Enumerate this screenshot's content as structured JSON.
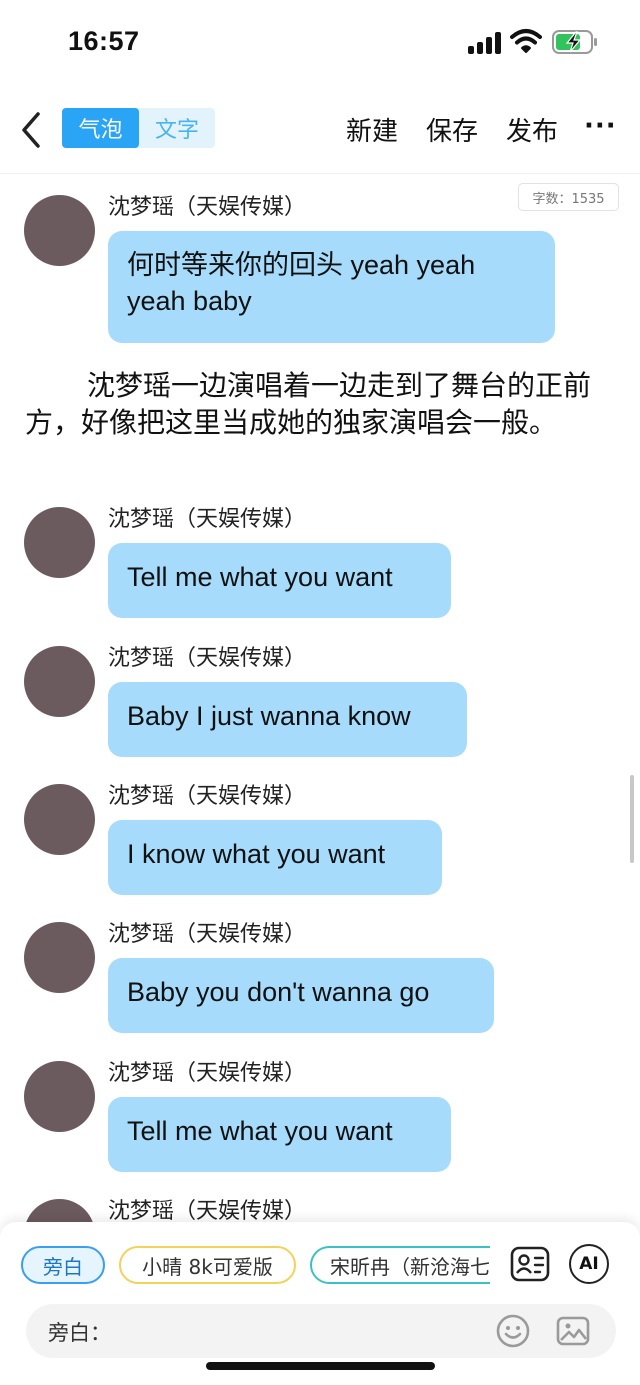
{
  "status": {
    "time": "16:57"
  },
  "nav": {
    "tab_bubble": "气泡",
    "tab_text": "文字",
    "new_label": "新建",
    "save_label": "保存",
    "publish_label": "发布",
    "more_label": "···"
  },
  "word_count": "字数：1535",
  "messages": [
    {
      "name": "沈梦瑶（天娱传媒）",
      "text": "何时等来你的回头 yeah yeah",
      "text2": "yeah baby"
    },
    {
      "name": "沈梦瑶（天娱传媒）",
      "text": "Tell me what you want"
    },
    {
      "name": "沈梦瑶（天娱传媒）",
      "text": "Baby I just wanna know"
    },
    {
      "name": "沈梦瑶（天娱传媒）",
      "text": "I know what you want"
    },
    {
      "name": "沈梦瑶（天娱传媒）",
      "text": "Baby you don't wanna go"
    },
    {
      "name": "沈梦瑶（天娱传媒）",
      "text": "Tell me what you want"
    },
    {
      "name": "沈梦瑶（天娱传媒）"
    }
  ],
  "narration": "沈梦瑶一边演唱着一边走到了舞台的正前方，好像把这里当成她的独家演唱会一般。",
  "bottom": {
    "chips": [
      "旁白",
      "小晴 8k可爱版",
      "宋昕冉（新沧海七"
    ],
    "ai_label": "AI",
    "input_label": "旁白："
  },
  "colors": {
    "accent": "#2aa4f4",
    "bubble": "#a6dbfb"
  }
}
